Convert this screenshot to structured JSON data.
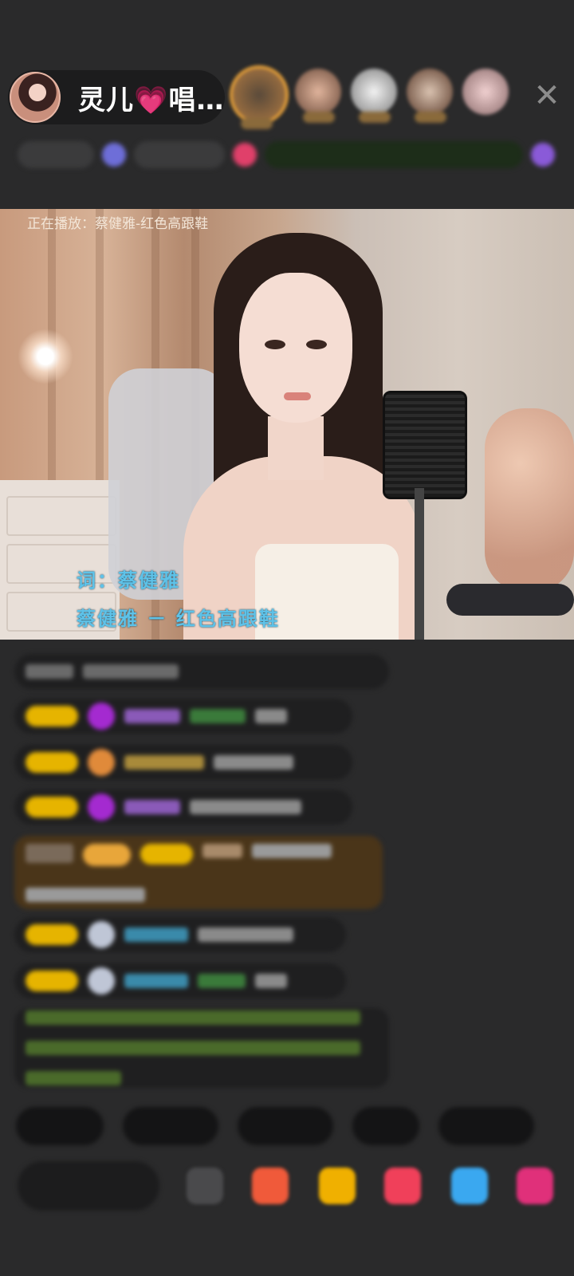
{
  "header": {
    "host_name": "灵儿💗唱…",
    "close_glyph": "✕"
  },
  "video": {
    "now_playing": "正在播放：蔡健雅-红色高跟鞋",
    "lyric_line_1": "词：蔡健雅",
    "lyric_line_2": "蔡健雅 － 红色高跟鞋"
  },
  "icons": {
    "close": "close-icon",
    "host_avatar": "avatar",
    "gift": "gift-icon",
    "share": "share-icon"
  },
  "colors": {
    "background": "#2a2a2b",
    "lyric": "#5ec2e8",
    "level_badge": "#e6b400",
    "notice_text": "#8cc63f",
    "highlight_message": "#4a3519"
  }
}
